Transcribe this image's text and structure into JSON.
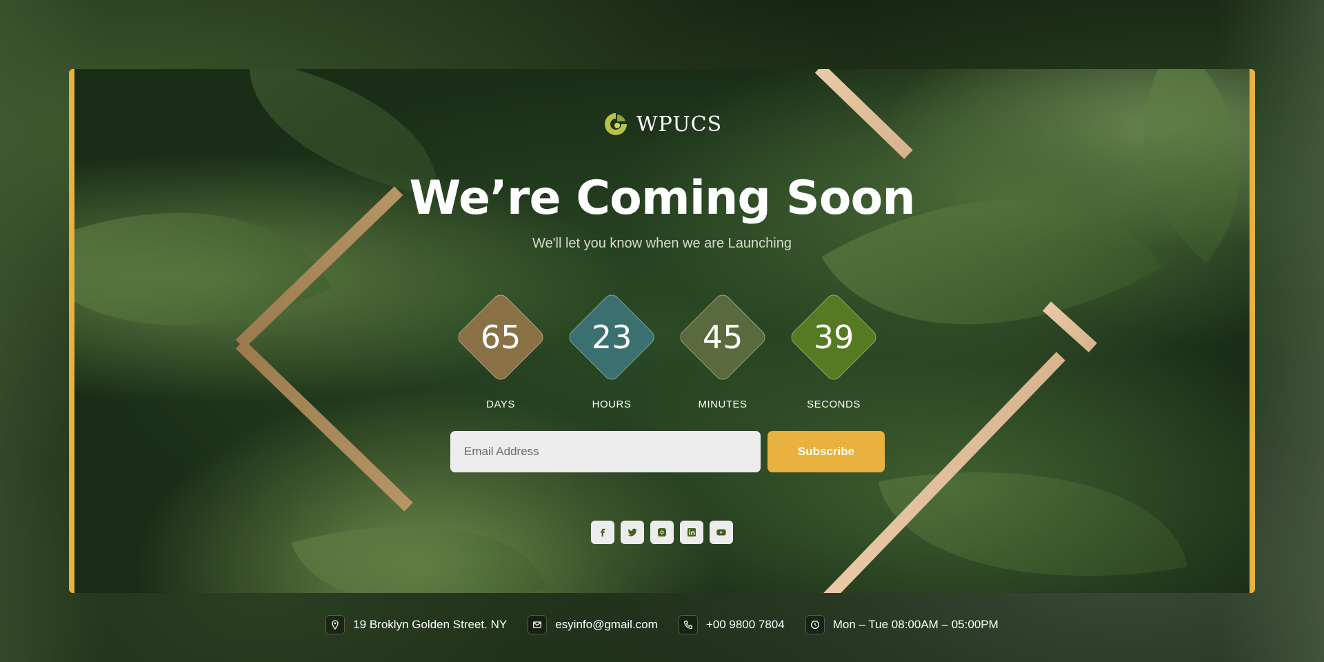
{
  "brand": {
    "name": "WPUCS",
    "accent": "#e9b13d"
  },
  "hero": {
    "title": "We’re Coming Soon",
    "subtitle": "We'll let you know when we are Launching"
  },
  "countdown": [
    {
      "value": "65",
      "label": "DAYS",
      "color": "#8a7145"
    },
    {
      "value": "23",
      "label": "HOURS",
      "color": "#3a7070"
    },
    {
      "value": "45",
      "label": "MINUTES",
      "color": "#5a6a3e"
    },
    {
      "value": "39",
      "label": "SECONDS",
      "color": "#557a22"
    }
  ],
  "subscribe": {
    "email_placeholder": "Email Address",
    "button_label": "Subscribe"
  },
  "socials": [
    "facebook-icon",
    "twitter-icon",
    "instagram-icon",
    "linkedin-icon",
    "youtube-icon"
  ],
  "footer": {
    "address": "19 Broklyn Golden Street. NY",
    "email": "esyinfo@gmail.com",
    "phone": "+00 9800 7804",
    "hours": "Mon – Tue 08:00AM – 05:00PM"
  }
}
